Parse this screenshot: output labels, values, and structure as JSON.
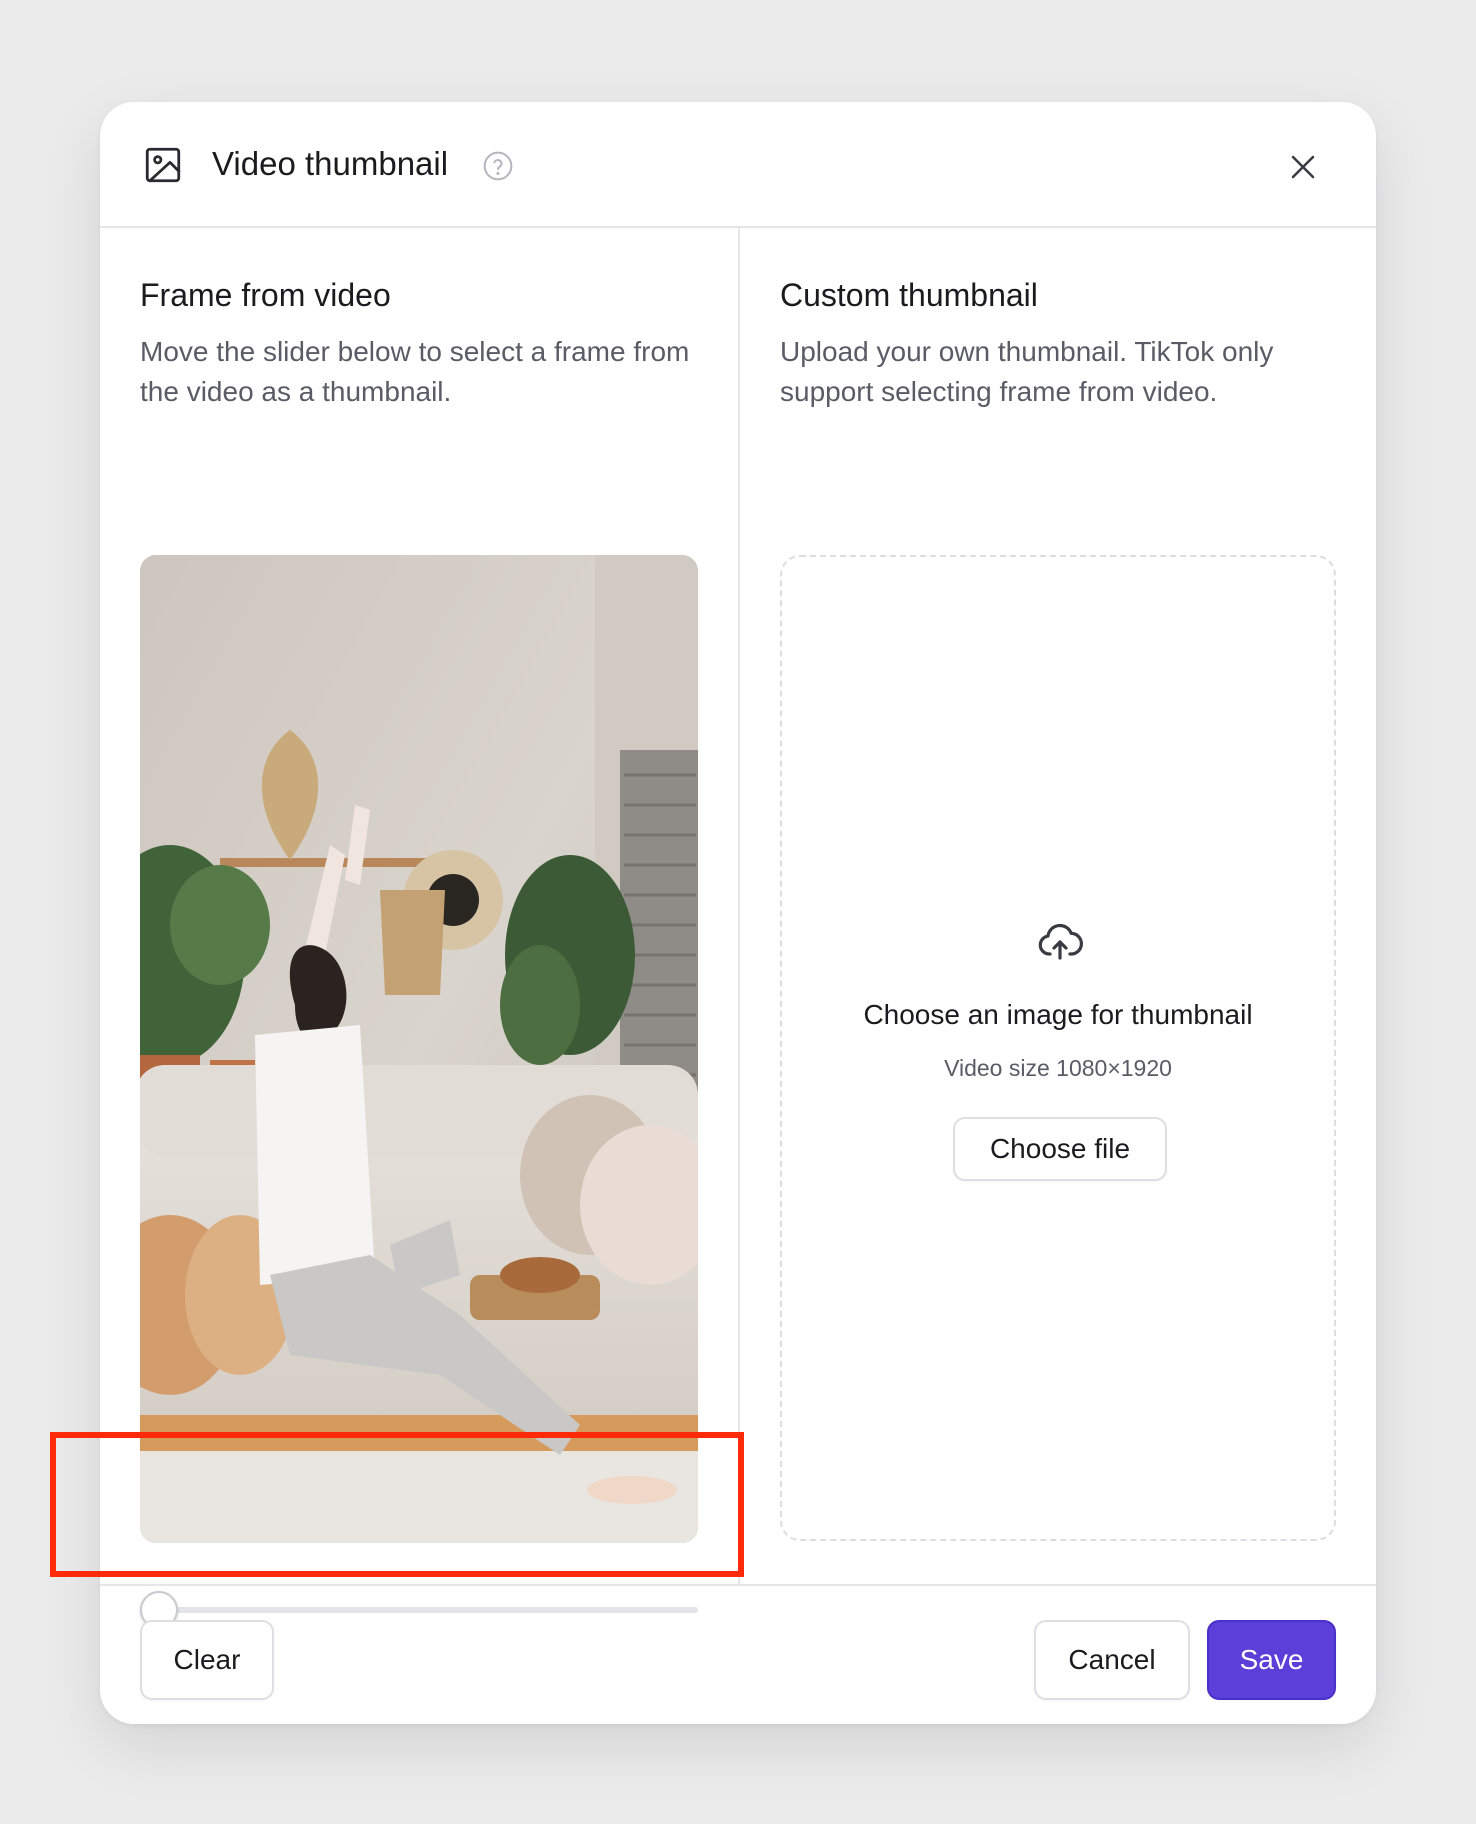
{
  "dialog": {
    "title": "Video thumbnail",
    "title_icon": "image-icon",
    "help_icon": "question-circle-icon",
    "close_icon": "close-icon"
  },
  "frame_section": {
    "title": "Frame from video",
    "description": "Move the slider below to select a frame from the video as a thumbnail.",
    "slider_position_fraction": 0
  },
  "custom_section": {
    "title": "Custom thumbnail",
    "description": "Upload your own thumbnail. TikTok only support selecting frame from video.",
    "upload_icon": "cloud-upload-icon",
    "dropzone_title": "Choose an image for thumbnail",
    "dropzone_subtitle": "Video size 1080×1920",
    "choose_file_label": "Choose file"
  },
  "footer": {
    "clear_label": "Clear",
    "cancel_label": "Cancel",
    "save_label": "Save"
  },
  "colors": {
    "accent": "#5b3fd8",
    "highlight": "#ff2a0a"
  }
}
